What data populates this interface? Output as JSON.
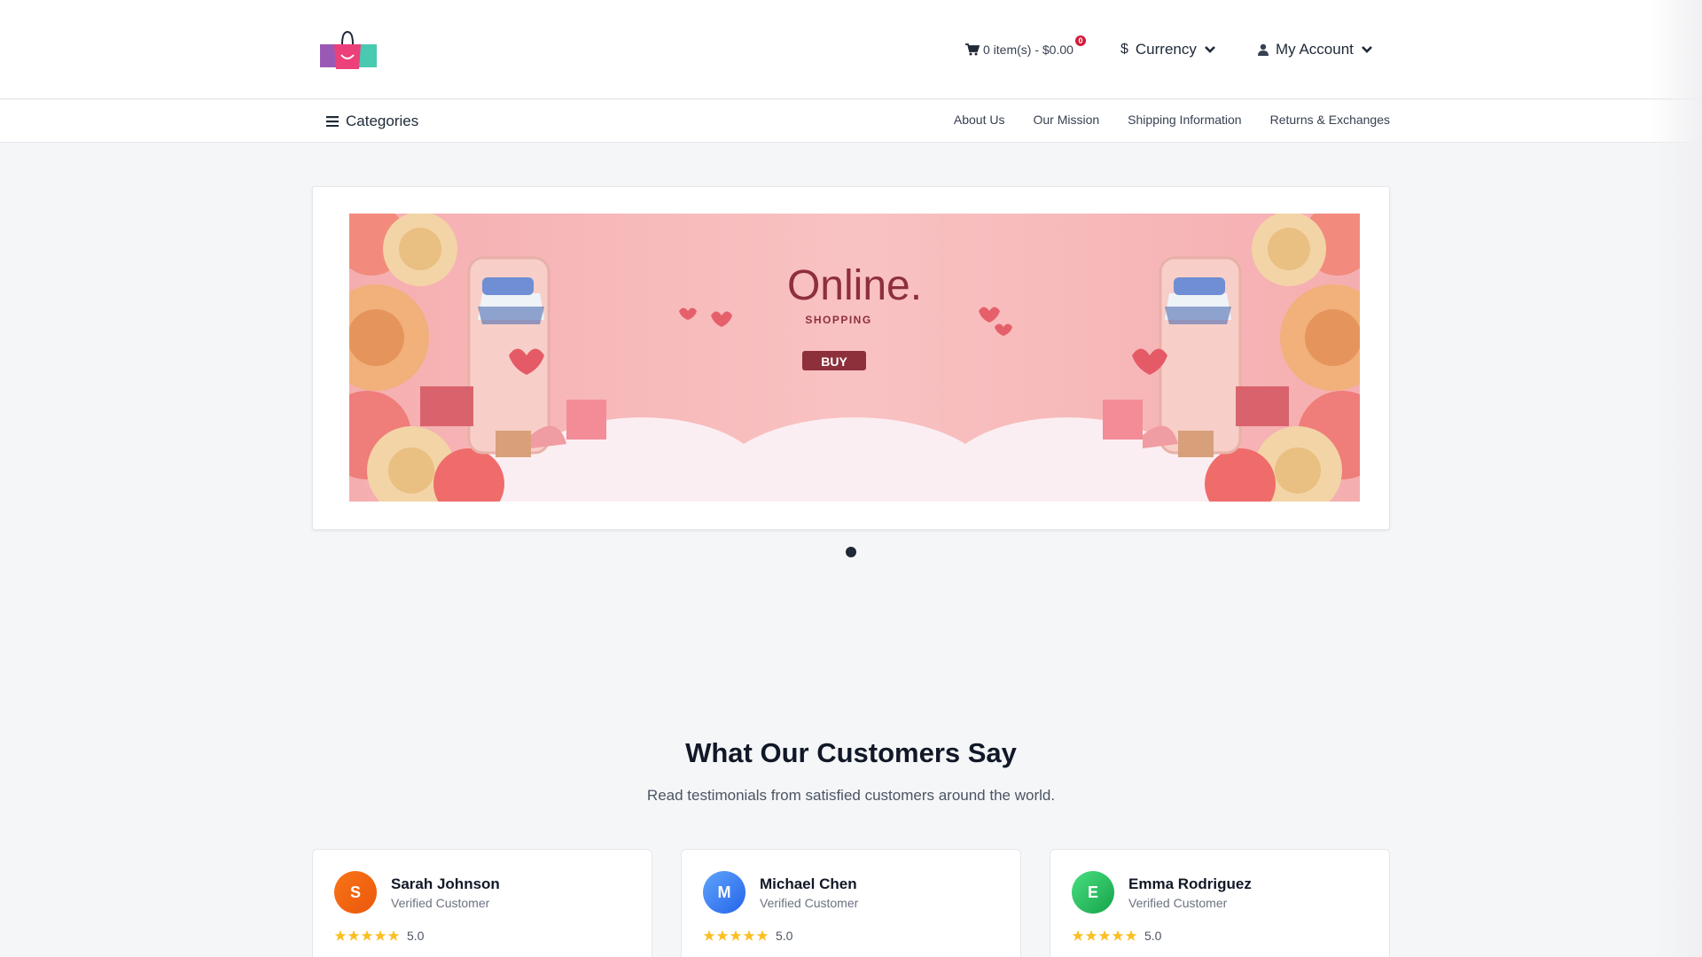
{
  "header": {
    "logo": "shopping-bag-logo",
    "cart_label": "0 item(s) - $0.00",
    "cart_count": "0",
    "currency_label": "Currency",
    "account_label": "My Account"
  },
  "nav": {
    "categories_label": "Categories",
    "links": [
      "About Us",
      "Our Mission",
      "Shipping Information",
      "Returns & Exchanges"
    ]
  },
  "banner": {
    "headline": "Online.",
    "subline": "SHOPPING",
    "button_label": "BUY",
    "slide_count": 1,
    "active_slide": 1
  },
  "testimonials": {
    "title": "What Our Customers Say",
    "subtitle": "Read testimonials from satisfied customers around the world.",
    "items": [
      {
        "initial": "S",
        "name": "Sarah Johnson",
        "role": "Verified Customer",
        "rating": "5.0",
        "color": "#f26b1d"
      },
      {
        "initial": "M",
        "name": "Michael Chen",
        "role": "Verified Customer",
        "rating": "5.0",
        "color": "#3b82f6"
      },
      {
        "initial": "E",
        "name": "Emma Rodriguez",
        "role": "Verified Customer",
        "rating": "5.0",
        "color": "#22c55e"
      }
    ]
  },
  "colors": {
    "accent": "#d41a3b",
    "star": "#fbbf24",
    "banner_pink": "#f7b8b8"
  }
}
